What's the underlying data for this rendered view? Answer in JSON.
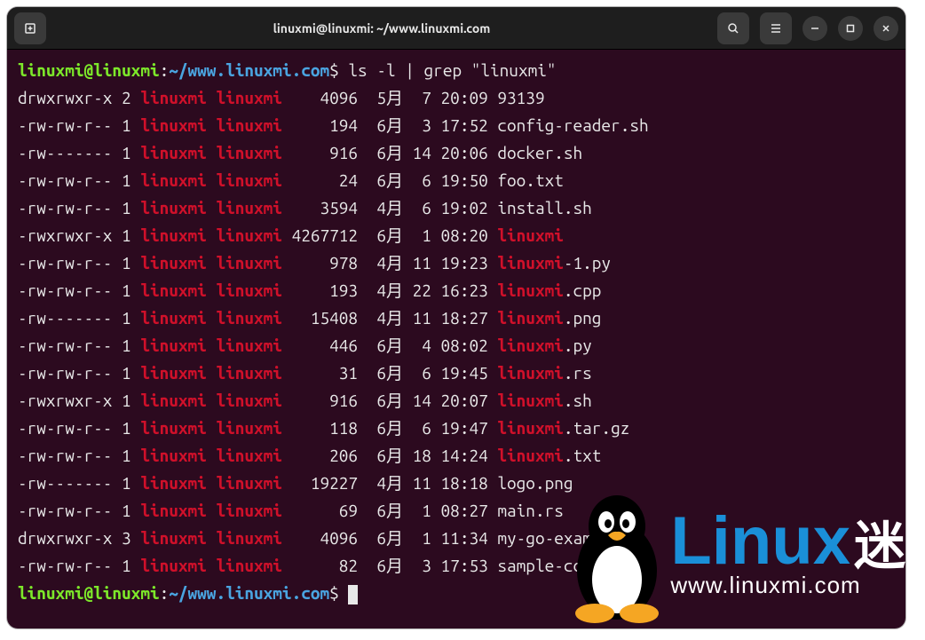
{
  "window": {
    "title": "linuxmi@linuxmi: ~/www.linuxmi.com"
  },
  "prompt": {
    "user": "linuxmi",
    "at": "@",
    "host": "linuxmi",
    "colon": ":",
    "path": "~/www.linuxmi.com",
    "dollar": "$"
  },
  "command": "ls -l | grep \"linuxmi\"",
  "rows": [
    {
      "perms": "drwxrwxr-x 2 ",
      "owner": "linuxmi linuxmi",
      "size": "    4096",
      "date": "  5月  7 20:09 ",
      "name_pre": "93139",
      "name_match": "",
      "name_post": ""
    },
    {
      "perms": "-rw-rw-r-- 1 ",
      "owner": "linuxmi linuxmi",
      "size": "     194",
      "date": "  6月  3 17:52 ",
      "name_pre": "config-reader.sh",
      "name_match": "",
      "name_post": ""
    },
    {
      "perms": "-rw------- 1 ",
      "owner": "linuxmi linuxmi",
      "size": "     916",
      "date": "  6月 14 20:06 ",
      "name_pre": "docker.sh",
      "name_match": "",
      "name_post": ""
    },
    {
      "perms": "-rw-rw-r-- 1 ",
      "owner": "linuxmi linuxmi",
      "size": "      24",
      "date": "  6月  6 19:50 ",
      "name_pre": "foo.txt",
      "name_match": "",
      "name_post": ""
    },
    {
      "perms": "-rw-rw-r-- 1 ",
      "owner": "linuxmi linuxmi",
      "size": "    3594",
      "date": "  4月  6 19:02 ",
      "name_pre": "install.sh",
      "name_match": "",
      "name_post": ""
    },
    {
      "perms": "-rwxrwxr-x 1 ",
      "owner": "linuxmi linuxmi",
      "size": " 4267712",
      "date": "  6月  1 08:20 ",
      "name_pre": "",
      "name_match": "linuxmi",
      "name_post": ""
    },
    {
      "perms": "-rw-rw-r-- 1 ",
      "owner": "linuxmi linuxmi",
      "size": "     978",
      "date": "  4月 11 19:23 ",
      "name_pre": "",
      "name_match": "linuxmi",
      "name_post": "-1.py"
    },
    {
      "perms": "-rw-rw-r-- 1 ",
      "owner": "linuxmi linuxmi",
      "size": "     193",
      "date": "  4月 22 16:23 ",
      "name_pre": "",
      "name_match": "linuxmi",
      "name_post": ".cpp"
    },
    {
      "perms": "-rw------- 1 ",
      "owner": "linuxmi linuxmi",
      "size": "   15408",
      "date": "  4月 11 18:27 ",
      "name_pre": "",
      "name_match": "linuxmi",
      "name_post": ".png"
    },
    {
      "perms": "-rw-rw-r-- 1 ",
      "owner": "linuxmi linuxmi",
      "size": "     446",
      "date": "  6月  4 08:02 ",
      "name_pre": "",
      "name_match": "linuxmi",
      "name_post": ".py"
    },
    {
      "perms": "-rw-rw-r-- 1 ",
      "owner": "linuxmi linuxmi",
      "size": "      31",
      "date": "  6月  6 19:45 ",
      "name_pre": "",
      "name_match": "linuxmi",
      "name_post": ".rs"
    },
    {
      "perms": "-rwxrwxr-x 1 ",
      "owner": "linuxmi linuxmi",
      "size": "     916",
      "date": "  6月 14 20:07 ",
      "name_pre": "",
      "name_match": "linuxmi",
      "name_post": ".sh"
    },
    {
      "perms": "-rw-rw-r-- 1 ",
      "owner": "linuxmi linuxmi",
      "size": "     118",
      "date": "  6月  6 19:47 ",
      "name_pre": "",
      "name_match": "linuxmi",
      "name_post": ".tar.gz"
    },
    {
      "perms": "-rw-rw-r-- 1 ",
      "owner": "linuxmi linuxmi",
      "size": "     206",
      "date": "  6月 18 14:24 ",
      "name_pre": "",
      "name_match": "linuxmi",
      "name_post": ".txt"
    },
    {
      "perms": "-rw------- 1 ",
      "owner": "linuxmi linuxmi",
      "size": "   19227",
      "date": "  4月 11 18:18 ",
      "name_pre": "logo.png",
      "name_match": "",
      "name_post": ""
    },
    {
      "perms": "-rw-rw-r-- 1 ",
      "owner": "linuxmi linuxmi",
      "size": "      69",
      "date": "  6月  1 08:27 ",
      "name_pre": "main.rs",
      "name_match": "",
      "name_post": ""
    },
    {
      "perms": "drwxrwxr-x 3 ",
      "owner": "linuxmi linuxmi",
      "size": "    4096",
      "date": "  6月  1 11:34 ",
      "name_pre": "my-go-example",
      "name_match": "",
      "name_post": ""
    },
    {
      "perms": "-rw-rw-r-- 1 ",
      "owner": "linuxmi linuxmi",
      "size": "      82",
      "date": "  6月  3 17:53 ",
      "name_pre": "sample-config.sh",
      "name_match": "",
      "name_post": ""
    }
  ],
  "watermark": {
    "title_en": "Linux",
    "title_cn": "迷",
    "url": "www.linuxmi.com"
  }
}
